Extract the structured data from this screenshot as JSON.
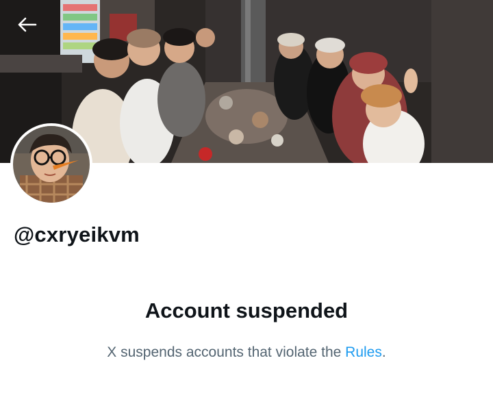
{
  "profile": {
    "handle": "@cxryeikvm"
  },
  "notice": {
    "title": "Account suspended",
    "body_prefix": "X suspends accounts that violate the ",
    "link_text": "Rules",
    "body_suffix": "."
  },
  "icons": {
    "back": "arrow-left-icon"
  },
  "colors": {
    "link": "#1d9bf0",
    "muted_text": "#536471",
    "primary_text": "#0f1419"
  }
}
